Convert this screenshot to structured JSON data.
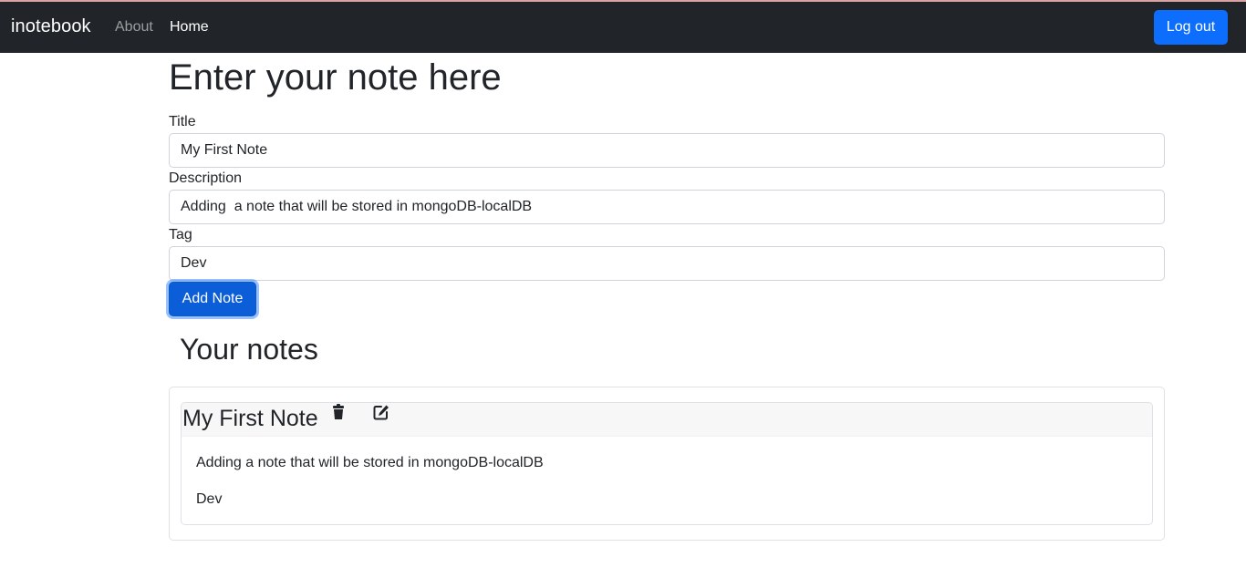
{
  "navbar": {
    "brand": "inotebook",
    "links": [
      {
        "label": "About"
      },
      {
        "label": "Home"
      }
    ],
    "logout_label": "Log out"
  },
  "form": {
    "heading": "Enter your note here",
    "title_label": "Title",
    "title_value": "My First Note",
    "description_label": "Description",
    "description_value": "Adding  a note that will be stored in mongoDB-localDB",
    "tag_label": "Tag",
    "tag_value": "Dev",
    "submit_label": "Add Note"
  },
  "notes": {
    "heading": "Your notes",
    "items": [
      {
        "title": "My First Note",
        "description": "Adding a note that will be stored in mongoDB-localDB",
        "tag": "Dev",
        "icons": [
          "trash-icon",
          "edit-icon"
        ]
      }
    ]
  },
  "colors": {
    "navbar_bg": "#212529",
    "primary": "#0d6efd",
    "primary_active": "#0b5ed7"
  }
}
